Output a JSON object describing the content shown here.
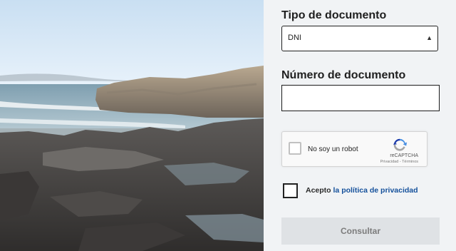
{
  "form": {
    "tipo_label": "Tipo de documento",
    "tipo_value": "DNI",
    "numero_label": "Número de documento",
    "numero_value": "",
    "recaptcha_text": "No soy un robot",
    "recaptcha_brand": "reCAPTCHA",
    "recaptcha_links": "Privacidad - Términos",
    "acepto_text": "Acepto ",
    "acepto_link": "la política de privacidad",
    "submit_label": "Consultar"
  },
  "colors": {
    "panel_bg": "#f1f3f5",
    "link": "#14509b",
    "button_bg": "#dfe2e5",
    "button_text": "#7c7c7c"
  }
}
